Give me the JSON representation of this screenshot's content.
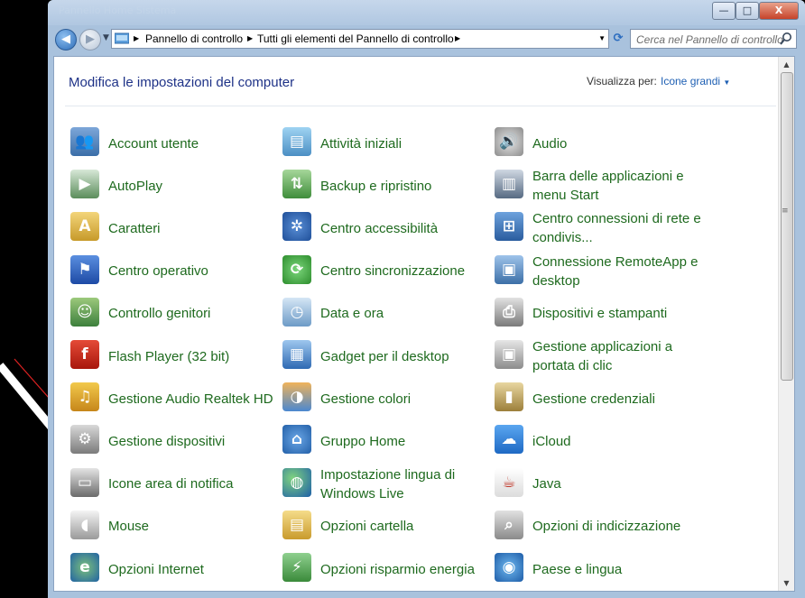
{
  "window": {
    "ghost_title": "Pannello   Home   Sistema   ",
    "buttons": {
      "minimize": "—",
      "maximize": "□",
      "close": "X"
    }
  },
  "navbar": {
    "breadcrumbs": [
      "Pannello di controllo",
      "Tutti gli elementi del Pannello di controllo"
    ],
    "search_placeholder": "Cerca nel Pannello di controllo"
  },
  "header": {
    "title": "Modifica le impostazioni del computer",
    "view_label": "Visualizza per:",
    "view_value": "Icone grandi"
  },
  "colors": {
    "link_green": "#1e6a1e",
    "title_blue": "#1e3287",
    "accent_blue": "#1e5fb3"
  },
  "items": [
    {
      "label": "Account utente",
      "icon": "users-icon"
    },
    {
      "label": "Attività iniziali",
      "icon": "getting-started-icon"
    },
    {
      "label": "Audio",
      "icon": "speaker-icon"
    },
    {
      "label": "AutoPlay",
      "icon": "autoplay-icon"
    },
    {
      "label": "Backup e ripristino",
      "icon": "backup-icon"
    },
    {
      "label": "Barra delle applicazioni e menu Start",
      "icon": "taskbar-icon"
    },
    {
      "label": "Caratteri",
      "icon": "fonts-icon"
    },
    {
      "label": "Centro accessibilità",
      "icon": "accessibility-icon"
    },
    {
      "label": "Centro connessioni di rete e condivis...",
      "icon": "network-icon"
    },
    {
      "label": "Centro operativo",
      "icon": "action-center-flag-icon"
    },
    {
      "label": "Centro sincronizzazione",
      "icon": "sync-icon"
    },
    {
      "label": "Connessione RemoteApp e desktop",
      "icon": "remoteapp-icon"
    },
    {
      "label": "Controllo genitori",
      "icon": "parental-controls-icon"
    },
    {
      "label": "Data e ora",
      "icon": "calendar-clock-icon"
    },
    {
      "label": "Dispositivi e stampanti",
      "icon": "printer-icon"
    },
    {
      "label": "Flash Player (32 bit)",
      "icon": "flash-icon"
    },
    {
      "label": "Gadget per il desktop",
      "icon": "gadgets-icon"
    },
    {
      "label": "Gestione applicazioni a portata di clic",
      "icon": "default-programs-icon"
    },
    {
      "label": "Gestione Audio Realtek HD",
      "icon": "realtek-audio-icon"
    },
    {
      "label": "Gestione colori",
      "icon": "color-management-icon"
    },
    {
      "label": "Gestione credenziali",
      "icon": "credentials-vault-icon"
    },
    {
      "label": "Gestione dispositivi",
      "icon": "device-manager-icon"
    },
    {
      "label": "Gruppo Home",
      "icon": "homegroup-icon"
    },
    {
      "label": "iCloud",
      "icon": "icloud-icon"
    },
    {
      "label": "Icone area di notifica",
      "icon": "notification-area-icon"
    },
    {
      "label": "Impostazione lingua di Windows Live",
      "icon": "globe-icon"
    },
    {
      "label": "Java",
      "icon": "java-icon"
    },
    {
      "label": "Mouse",
      "icon": "mouse-icon"
    },
    {
      "label": "Opzioni cartella",
      "icon": "folder-options-icon"
    },
    {
      "label": "Opzioni di indicizzazione",
      "icon": "indexing-icon"
    },
    {
      "label": "Opzioni Internet",
      "icon": "internet-options-icon"
    },
    {
      "label": "Opzioni risparmio energia",
      "icon": "power-options-icon"
    },
    {
      "label": "Paese e lingua",
      "icon": "region-language-icon"
    }
  ]
}
